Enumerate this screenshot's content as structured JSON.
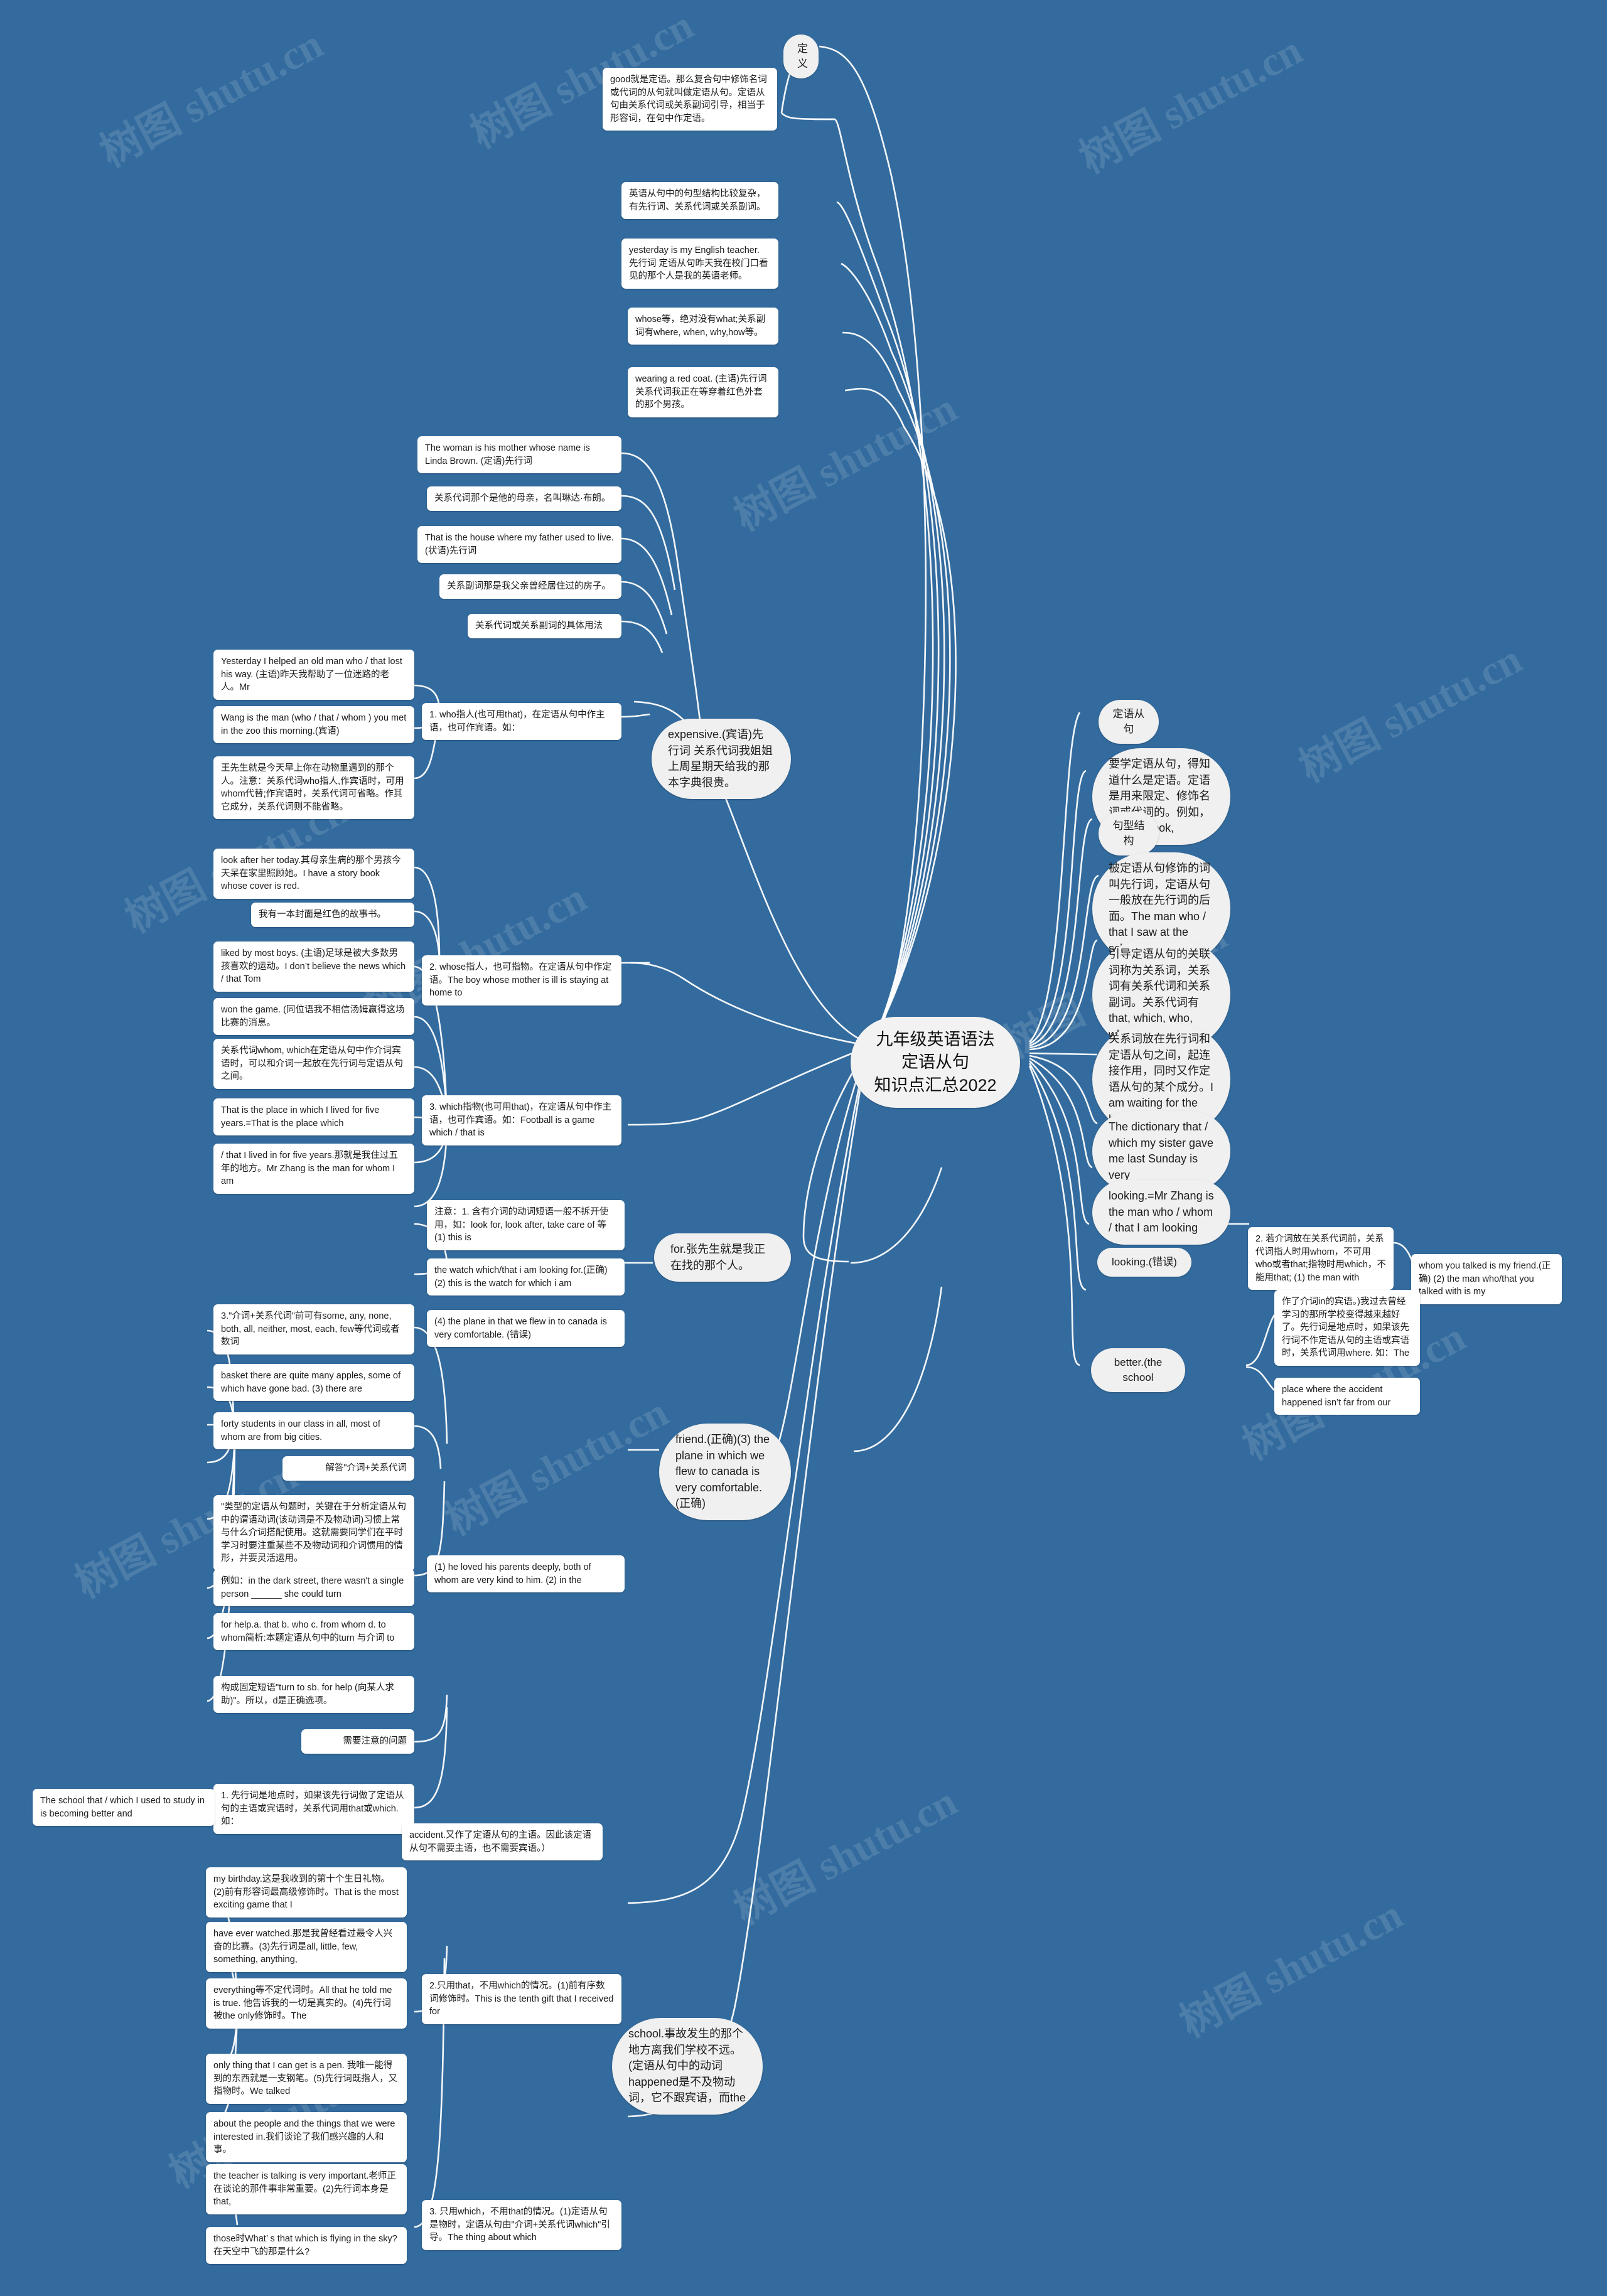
{
  "meta": {
    "background_color": "#336b9e",
    "node_color": "#ffffff",
    "pill_color": "#f0f0f0",
    "link_color": "#ffffff",
    "watermark_text": "树图 shutu.cn"
  },
  "root": {
    "label": "九年级英语语法定语从句\n知识点汇总2022"
  },
  "branches": {
    "definition_title": "定义",
    "definition_items": [
      "good就是定语。那么复合句中修饰名词或代词的从句就叫做定语从句。定语从句由关系代词或关系副词引导，相当于形容词，在句中作定语。",
      "英语从句中的句型结构比较复杂，有先行词、关系代词或关系副词。",
      "yesterday is my English teacher. 先行词 定语从句昨天我在校门口看见的那个人是我的英语老师。",
      "whose等，绝对没有what;关系副词有where, when, why,how等。",
      "wearing a red coat. (主语)先行词 关系代词我正在等穿着红色外套的那个男孩。"
    ],
    "examples_col": [
      "The woman is his mother whose name is Linda Brown. (定语)先行词",
      "关系代词那个是他的母亲，名叫琳达·布朗。",
      "That is the house where my father used to live.(状语)先行词",
      "关系副词那是我父亲曾经居住过的房子。",
      "关系代词或关系副词的具体用法"
    ],
    "who_group": {
      "title": "1. who指人(也可用that)，在定语从句中作主语，也可作宾语。如：",
      "items": [
        "Yesterday I helped an old man who / that lost his way. (主语)昨天我帮助了一位迷路的老人。Mr",
        "Wang is the man (who / that / whom ) you met in the zoo this morning.(宾语)",
        "王先生就是今天早上你在动物里遇到的那个人。注意：关系代词who指人,作宾语时，可用whom代替;作宾语时，关系代词可省略。作其它成分，关系代词则不能省略。"
      ]
    },
    "whose_group": {
      "title": "2. whose指人，也可指物。在定语从句中作定语。The boy whose mother is ill is staying at home to",
      "items": [
        "look after her today.其母亲生病的那个男孩今天呆在家里照顾她。I have a story book whose cover is red.",
        "我有一本封面是红色的故事书。"
      ]
    },
    "which_group": {
      "title": "3. which指物(也可用that)，在定语从句中作主语，也可作宾语。如：Football is a game which / that is",
      "items": [
        "liked by most boys. (主语)足球是被大多数男孩喜欢的运动。I don’t believe the news which / that Tom",
        "won the game. (同位语我不相信汤姆赢得这场比赛的消息。",
        "关系代词whom, which在定语从句中作介词宾语时，可以和介词一起放在先行词与定语从句之间。",
        "That is the place in which I lived for five years.=That is the place which",
        "/ that I lived in for five years.那就是我住过五年的地方。Mr Zhang is the man for whom I am"
      ]
    },
    "expensive_node": "expensive.(宾语)先行词 关系代词我姐姐上周星期天给我的那本字典很贵。",
    "for_node": "for.张先生就是我正在找的那个人。",
    "note1_group": {
      "items": [
        "注意：1. 含有介词的动词短语一般不拆开使用，如：look for, look after, take care of 等 (1) this is",
        "the watch which/that i am looking for.(正确)(2) this is the watch for which i am"
      ]
    },
    "plane_node": "(4) the plane in that we flew in to canada is very comfortable. (错误)",
    "friend_node": "friend.(正确)(3) the plane in which we flew to canada is very comfortable. (正确)",
    "prep_group": {
      "title": "3.\"介词+关系代词\"前可有some, any, none, both, all, neither, most, each, few等代词或者数词",
      "items": [
        "basket there are quite many apples, some of which have gone bad. (3) there are",
        "forty students in our class in all, most of whom are from big cities."
      ]
    },
    "analysis_label": "解答\"介词+关系代词",
    "analysis_items": [
      "\"类型的定语从句题时，关键在于分析定语从句中的谓语动词(该动词是不及物动词)习惯上常与什么介词搭配使用。这就需要同学们在平时学习时要注重某些不及物动词和介词惯用的情形，并要灵活运用。",
      "例如：in the dark street, there wasn't a single person ______ she could turn",
      "for help.a. that b. who c. from whom d. to whom简析:本题定语从句中的turn 与介词 to",
      "构成固定短语\"turn to sb. for help (向某人求助)\"。所以，d是正确选项。"
    ],
    "loved_node": "(1) he loved his parents deeply, both of whom are very kind to him. (2) in the",
    "attention_label": "需要注意的问题",
    "place_rule_node": "1. 先行词是地点时，如果该先行词做了定语从句的主语或宾语时，关系代词用that或which. 如：",
    "school_node": "The school that / which I used to study in is becoming better and",
    "accident_node": "accident.又作了定语从句的主语。因此该定语从句不需要主语，也不需要宾语。）",
    "school_happened_node": "school.事故发生的那个地方离我们学校不远。(定语从句中的动词happened是不及物动词，它不跟宾语，而the",
    "that_only_group": {
      "title": "2.只用that，不用which的情况。(1)前有序数词修饰时。This is the tenth gift that I received for",
      "items": [
        "my birthday.这是我收到的第十个生日礼物。(2)前有形容词最高级修饰时。That is the most exciting game that I",
        "have ever watched.那是我曾经看过最令人兴奋的比赛。(3)先行词是all, little, few, something, anything,",
        "everything等不定代词时。All that he told me is true. 他告诉我的一切是真实的。(4)先行词被the only修饰时。The",
        "only thing that I can get is a pen. 我唯一能得到的东西就是一支钢笔。(5)先行词既指人，又指物时。We talked",
        "about the people and the things that we were interested in.我们谈论了我们感兴趣的人和事。"
      ]
    },
    "which_only_group": {
      "title": "3. 只用which，不用that的情况。(1)定语从句是物时，定语从句由\"介词+关系代词which\"引导。The thing about which",
      "items": [
        "the teacher is talking is very important.老师正在谈论的那件事非常重要。(2)先行词本身是that,",
        "those时What’ s that which is flying in the sky? 在天空中飞的那是什么?"
      ]
    }
  },
  "right_branch": {
    "title_1": "定语从句",
    "item_1": "要学定语从句，得知道什么是定语。定语是用来限定、修饰名词或代词的。例如，a good book,",
    "title_2": "句型结构",
    "item_2": "被定语从句修饰的词叫先行词，定语从句一般放在先行词的后面。The man who / that I saw at the school gate",
    "item_3": "引导定语从句的关联词称为关系词，关系词有关系代词和关系副词。关系代词有that, which, who, whom,",
    "item_4": "关系词放在先行词和定语从句之间，起连接作用，同时又作定语从句的某个成分。I am waiting for the boy who /that is",
    "item_5": "The dictionary that / which my sister gave me last Sunday is very",
    "item_6": "looking.=Mr Zhang is the man who / whom / that I am looking",
    "item_7": "looking.(错误)",
    "item_8": "2. 若介词放在关系代词前，关系代词指人时用whom，不可用who或者that;指物时用which，不能用that; (1) the man with",
    "item_9": "whom you talked is my friend.(正确) (2) the man who/that you talked with is my",
    "item_10": "better.(the school",
    "item_11": "作了介词in的宾语。)我过去曾经学习的那所学校变得越来越好了。先行词是地点时，如果该先行词不作定语从句的主语或宾语时，关系代词用where. 如：The",
    "item_12": "place where the accident happened isn’t far from our"
  }
}
